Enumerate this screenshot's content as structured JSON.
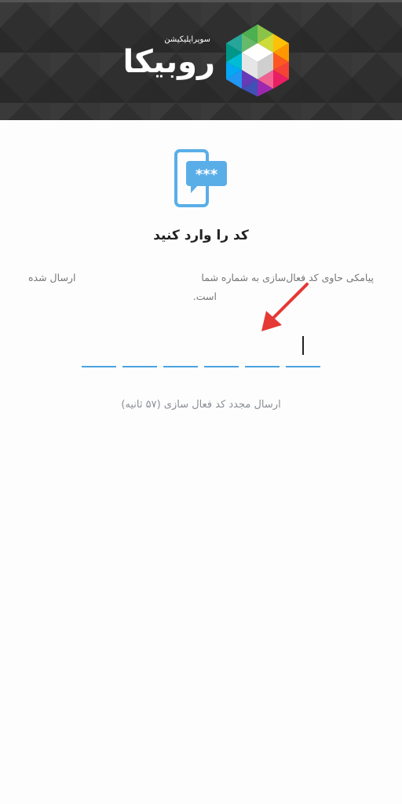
{
  "header": {
    "brand_name": "روبیکا",
    "tagline": "سوپراپلیکیشن",
    "background": "#2f2f2f",
    "logo_icon": "rubika-cube-logo-icon"
  },
  "verification": {
    "icon": "sms-message-icon",
    "title": "کد را وارد کنید",
    "message_line1_part1": "پیامکی حاوی کد فعال‌سازی به شماره شما",
    "message_line1_part2": "ارسال شده",
    "message_line2": "است.",
    "code_length": 6,
    "resend_text": "ارسال مجدد کد فعال سازی (۵۷ ثانیه)",
    "accent_color": "#4aa3df",
    "annotation_arrow_color": "#e53935"
  }
}
